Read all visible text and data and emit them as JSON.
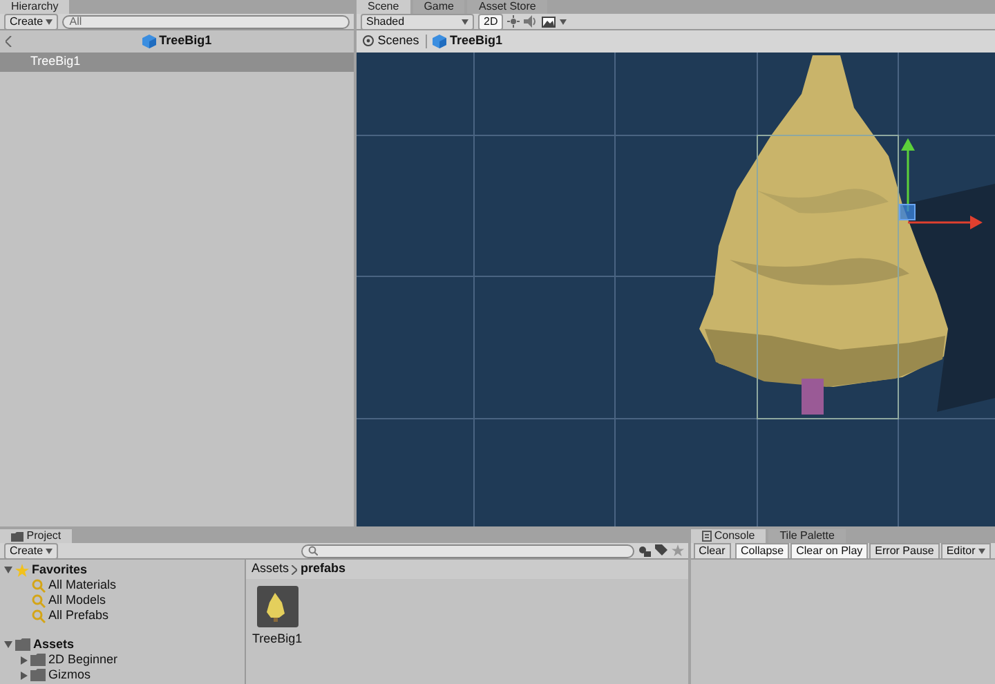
{
  "hierarchy": {
    "tab": "Hierarchy",
    "create": "Create",
    "search_placeholder": "All",
    "header": "TreeBig1",
    "items": [
      {
        "label": "TreeBig1",
        "selected": true
      }
    ]
  },
  "scene": {
    "tabs": [
      {
        "label": "Scene",
        "selected": true
      },
      {
        "label": "Game",
        "selected": false
      },
      {
        "label": "Asset Store",
        "selected": false
      }
    ],
    "shading": "Shaded",
    "mode_2d": {
      "label": "2D",
      "on": true
    },
    "breadcrumb": [
      "Scenes",
      "TreeBig1"
    ]
  },
  "project": {
    "tab": "Project",
    "create": "Create",
    "tree": [
      {
        "label": "Favorites",
        "kind": "favorites",
        "expanded": true,
        "children": [
          {
            "label": "All Materials",
            "kind": "search"
          },
          {
            "label": "All Models",
            "kind": "search"
          },
          {
            "label": "All Prefabs",
            "kind": "search"
          }
        ]
      },
      {
        "label": "Assets",
        "kind": "folder",
        "expanded": true,
        "children": [
          {
            "label": "2D Beginner",
            "kind": "folder",
            "expanded": false
          },
          {
            "label": "Gizmos",
            "kind": "folder",
            "expanded": false
          }
        ]
      }
    ],
    "path": [
      "Assets",
      "prefabs"
    ],
    "assets": [
      {
        "label": "TreeBig1"
      }
    ]
  },
  "console": {
    "tabs": [
      {
        "label": "Console",
        "selected": true
      },
      {
        "label": "Tile Palette",
        "selected": false
      }
    ],
    "toolbar": [
      {
        "label": "Clear",
        "kind": "button"
      },
      {
        "label": "Collapse",
        "kind": "toggle",
        "on": true
      },
      {
        "label": "Clear on Play",
        "kind": "toggle",
        "on": true
      },
      {
        "label": "Error Pause",
        "kind": "toggle",
        "on": false
      },
      {
        "label": "Editor",
        "kind": "dropdown"
      }
    ]
  }
}
